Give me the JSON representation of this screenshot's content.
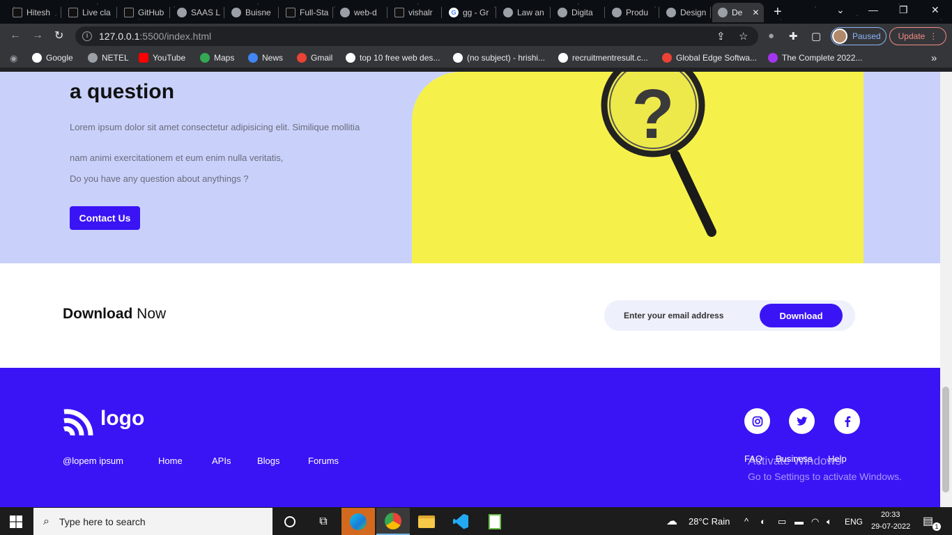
{
  "browser": {
    "tabs": [
      {
        "label": "Hitesh",
        "icon": "github-icon"
      },
      {
        "label": "Live cla",
        "icon": "github-icon"
      },
      {
        "label": "GitHub",
        "icon": "github-icon"
      },
      {
        "label": "SAAS L",
        "icon": "globe-icon"
      },
      {
        "label": "Buisne",
        "icon": "globe-icon"
      },
      {
        "label": "Full-Sta",
        "icon": "github-icon"
      },
      {
        "label": "web-d",
        "icon": "globe-icon"
      },
      {
        "label": "vishalr",
        "icon": "github-icon"
      },
      {
        "label": "gg - Gr",
        "icon": "google-icon"
      },
      {
        "label": "Law an",
        "icon": "globe-icon"
      },
      {
        "label": "Digita",
        "icon": "globe-icon"
      },
      {
        "label": "Produ",
        "icon": "globe-icon"
      },
      {
        "label": "Design",
        "icon": "globe-icon"
      },
      {
        "label": "De",
        "icon": "globe-icon",
        "active": true
      }
    ],
    "url_host": "127.0.0.1",
    "url_path": ":5500/index.html",
    "profile_status": "Paused",
    "update_label": "Update",
    "bookmarks": [
      "Google",
      "NETEL",
      "YouTube",
      "Maps",
      "News",
      "Gmail",
      "top 10 free web des...",
      "(no subject) - hrishi...",
      "recruitmentresult.c...",
      "Global Edge Softwa...",
      "The Complete 2022..."
    ]
  },
  "hero": {
    "heading": "a question",
    "para1": "Lorem ipsum dolor sit amet consectetur adipisicing elit. Similique mollitia",
    "para2": "nam animi exercitationem et eum enim nulla veritatis,",
    "para3": "Do you have any question about anythings ?",
    "cta": "Contact Us"
  },
  "download": {
    "title_bold": "Download",
    "title_rest": " Now",
    "email_placeholder": "Enter your email address",
    "button": "Download"
  },
  "footer": {
    "logo": "logo",
    "copyright": "@lopem ipsum",
    "nav": [
      "Home",
      "APIs",
      "Blogs",
      "Forums"
    ],
    "links": [
      "FAQ",
      "Business",
      "Help"
    ],
    "social": [
      "instagram-icon",
      "twitter-icon",
      "facebook-icon"
    ]
  },
  "watermark": {
    "line1": "Activate Windows",
    "line2": "Go to Settings to activate Windows."
  },
  "taskbar": {
    "search_placeholder": "Type here to search",
    "weather": "28°C  Rain",
    "lang": "ENG",
    "time": "20:33",
    "date": "29-07-2022",
    "notification_count": "1"
  },
  "colors": {
    "accent": "#3a14f5",
    "hero_bg": "#c9d1fb",
    "image_bg": "#f6f14a"
  }
}
